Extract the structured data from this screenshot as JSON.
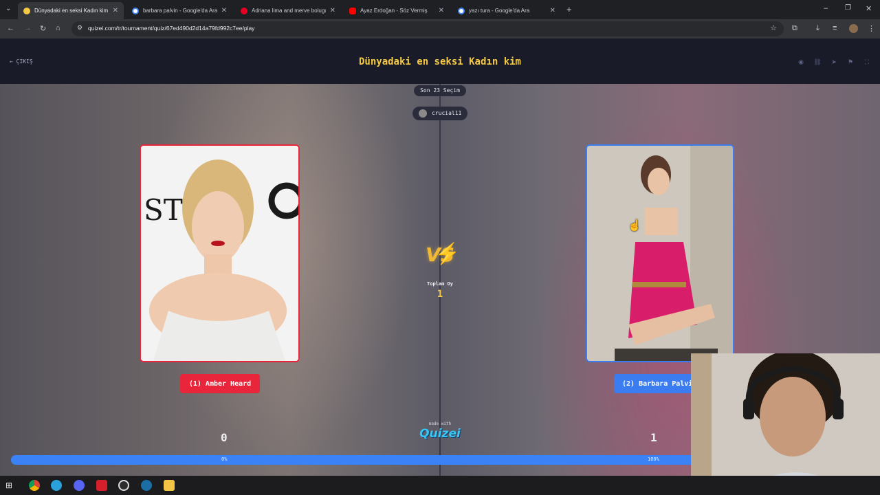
{
  "browser": {
    "tabs": [
      {
        "title": "Dünyadaki en seksi Kadın kim -",
        "active": true
      },
      {
        "title": "barbara palvin - Google'da Ara",
        "active": false
      },
      {
        "title": "Adriana lima and merve bolugu",
        "active": false
      },
      {
        "title": "Ayaz Erdoğan - Söz Vermiş",
        "active": false
      },
      {
        "title": "yazı tura - Google'da Ara",
        "active": false
      }
    ],
    "url": "quizei.com/tr/tournament/quiz/67ed490d2d14a79fd992c7ee/play"
  },
  "header": {
    "back_label": "ÇIKIŞ",
    "title": "Dünyadaki en seksi Kadın kim"
  },
  "match": {
    "round_label": "Son 23 Seçim",
    "user": "crucial11",
    "vs": "VS",
    "total_votes_label": "Toplam Oy",
    "total_votes": "1",
    "left": {
      "name": "(1) Amber Heard",
      "votes": "0",
      "percent_label": "0%"
    },
    "right": {
      "name": "(2) Barbara Palvin",
      "votes": "1",
      "percent_label": "100%"
    },
    "right_share": 1.0,
    "made_with": "made with",
    "brand": "Quizei"
  },
  "colors": {
    "left_accent": "#e8253a",
    "right_accent": "#3b7cf0",
    "title": "#f6c944",
    "bar": "#3b82f6"
  }
}
